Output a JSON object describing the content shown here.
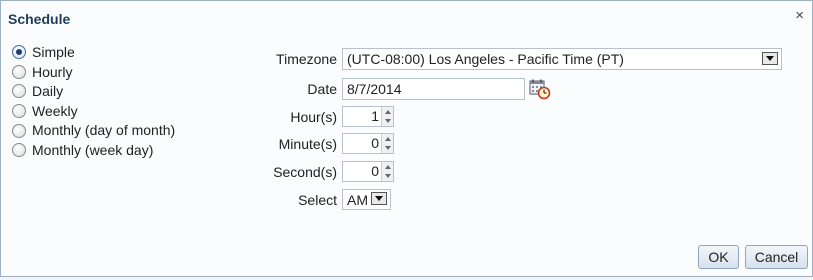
{
  "dialog": {
    "title": "Schedule",
    "close_symbol": "×"
  },
  "recurrence": {
    "options": [
      {
        "label": "Simple",
        "checked": true
      },
      {
        "label": "Hourly",
        "checked": false
      },
      {
        "label": "Daily",
        "checked": false
      },
      {
        "label": "Weekly",
        "checked": false
      },
      {
        "label": "Monthly (day of month)",
        "checked": false
      },
      {
        "label": "Monthly (week day)",
        "checked": false
      }
    ]
  },
  "form": {
    "timezone_label": "Timezone",
    "timezone_value": "(UTC-08:00) Los Angeles - Pacific Time (PT)",
    "date_label": "Date",
    "date_value": "8/7/2014",
    "hours_label": "Hour(s)",
    "hours_value": "1",
    "minutes_label": "Minute(s)",
    "minutes_value": "0",
    "seconds_label": "Second(s)",
    "seconds_value": "0",
    "select_label": "Select",
    "select_value": "AM"
  },
  "buttons": {
    "ok": "OK",
    "cancel": "Cancel"
  },
  "icons": {
    "calendar": "calendar-clock-icon",
    "close": "close-icon"
  },
  "colors": {
    "title": "#1f3c5c",
    "border": "#9eb0c4",
    "accent": "#3a6fb0"
  }
}
